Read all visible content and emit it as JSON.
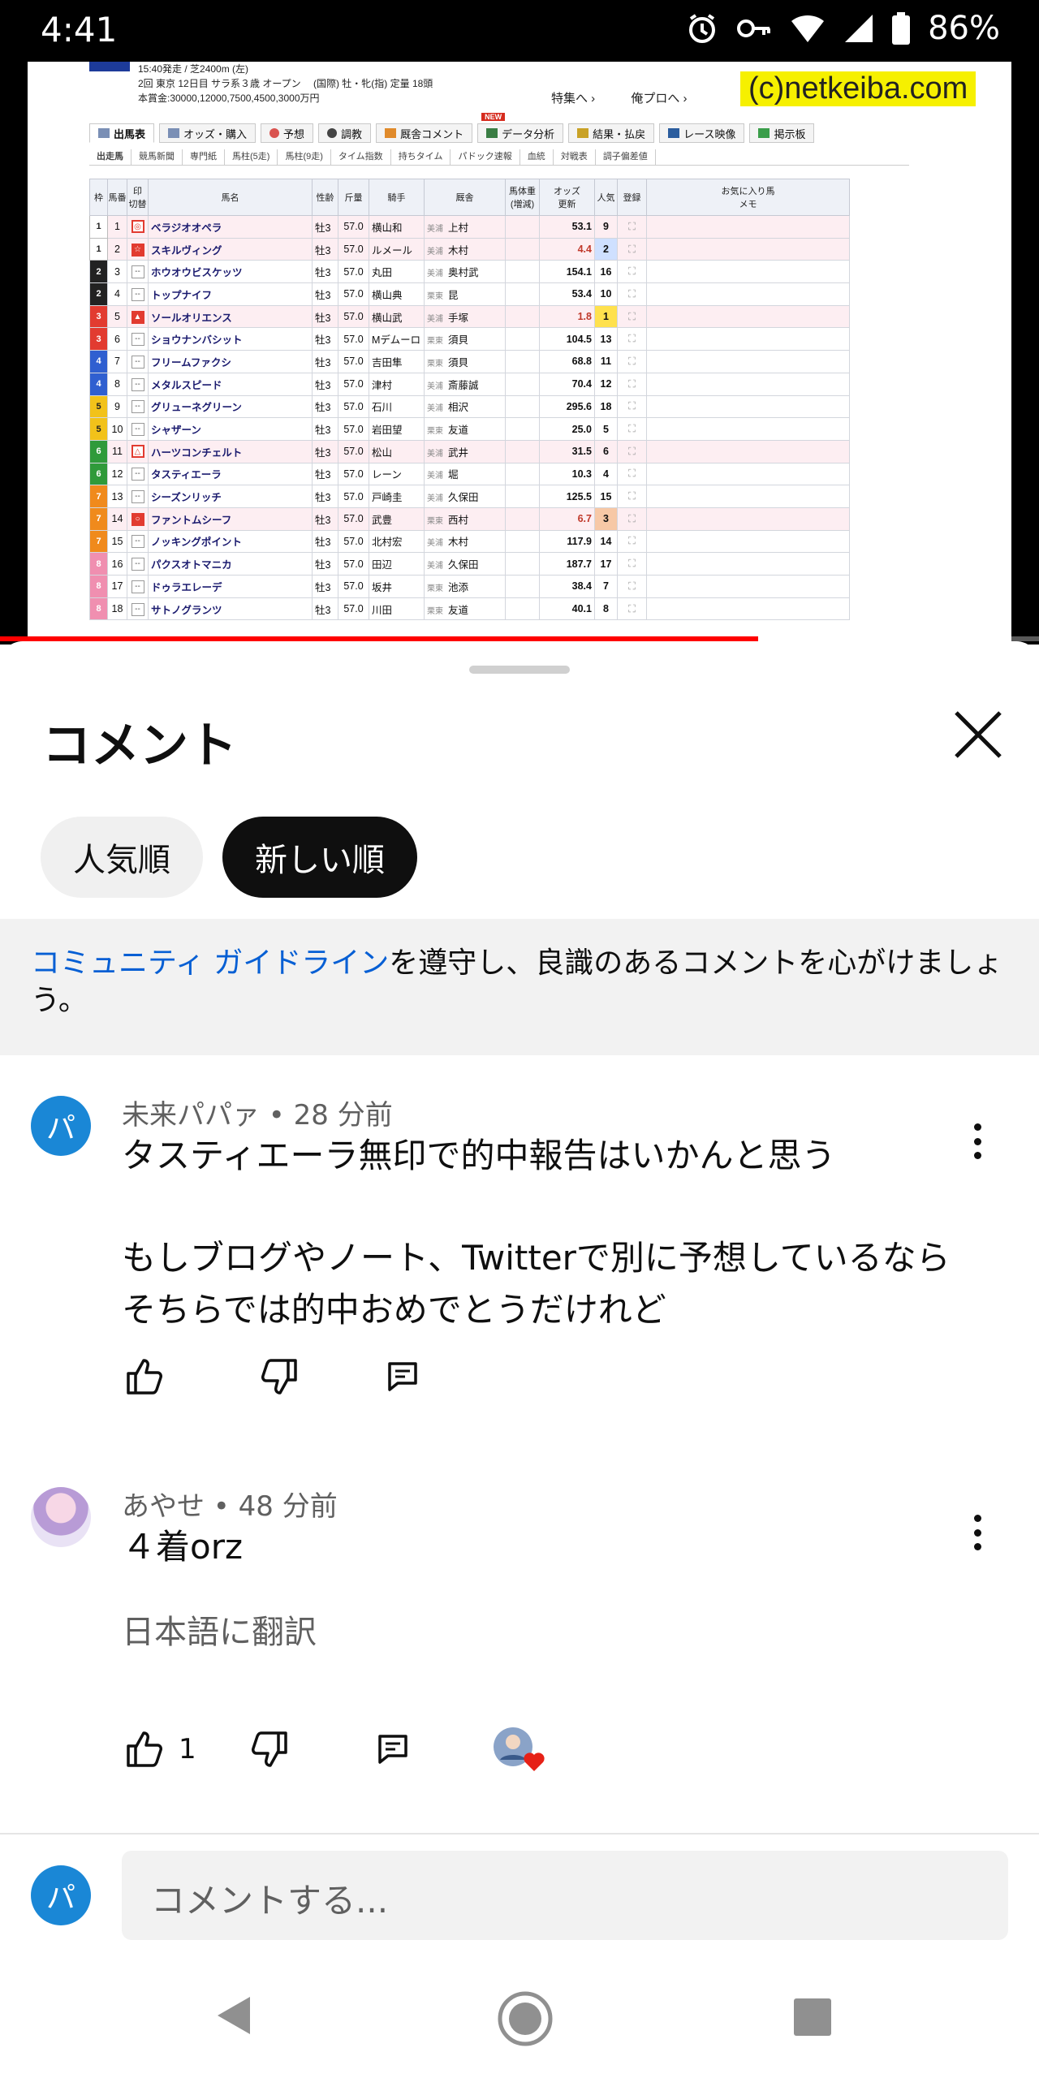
{
  "status_bar": {
    "time": "4:41",
    "battery": "86%"
  },
  "video": {
    "header_lines": [
      "15:40発走 / 芝2400m (左)",
      "2回 東京 12日目 サラ系３歳 オープン　 (国際) 牡・牝(指) 定量 18頭",
      "本賞金:30000,12000,7500,4500,3000万円"
    ],
    "links": [
      "特集へ ›",
      "俺プロへ ›"
    ],
    "watermark": "(c)netkeiba.com",
    "nav_tabs": [
      "出馬表",
      "オッズ・購入",
      "予想",
      "調教",
      "厩舎コメント",
      "データ分析",
      "結果・払戻",
      "レース映像",
      "掲示板"
    ],
    "new_badge": "NEW",
    "sub_tabs": [
      "出走馬",
      "競馬新聞",
      "専門紙",
      "馬柱(5走)",
      "馬柱(9走)",
      "タイム指数",
      "持ちタイム",
      "パドック速報",
      "血統",
      "対戦表",
      "調子偏差値"
    ],
    "table_headers": {
      "waku": "枠",
      "num": "馬番",
      "mark": "印",
      "mark_sub": "切替",
      "name": "馬名",
      "sex": "性齢",
      "wt": "斤量",
      "jockey": "騎手",
      "trainer": "厩舎",
      "bw": "馬体重",
      "bw_sub": "(増減)",
      "odds": "オッズ",
      "odds_sub": "更新",
      "pop": "人気",
      "fav": "お気に入り馬",
      "reg": "登録",
      "memo": "メモ"
    },
    "rows": [
      {
        "waku": "1",
        "num": "1",
        "mark": "◎",
        "name": "ベラジオオペラ",
        "sex": "牡3",
        "wt": "57.0",
        "jockey": "横山和",
        "loc": "美浦",
        "trainer": "上村",
        "odds": "53.1",
        "pop": "9"
      },
      {
        "waku": "1",
        "num": "2",
        "mark": "☆",
        "name": "スキルヴィング",
        "sex": "牡3",
        "wt": "57.0",
        "jockey": "ルメール",
        "loc": "美浦",
        "trainer": "木村",
        "odds": "4.4",
        "pop": "2"
      },
      {
        "waku": "2",
        "num": "3",
        "mark": "--",
        "name": "ホウオウビスケッツ",
        "sex": "牡3",
        "wt": "57.0",
        "jockey": "丸田",
        "loc": "美浦",
        "trainer": "奥村武",
        "odds": "154.1",
        "pop": "16"
      },
      {
        "waku": "2",
        "num": "4",
        "mark": "--",
        "name": "トップナイフ",
        "sex": "牡3",
        "wt": "57.0",
        "jockey": "横山典",
        "loc": "栗東",
        "trainer": "昆",
        "odds": "53.4",
        "pop": "10"
      },
      {
        "waku": "3",
        "num": "5",
        "mark": "▲",
        "name": "ソールオリエンス",
        "sex": "牡3",
        "wt": "57.0",
        "jockey": "横山武",
        "loc": "美浦",
        "trainer": "手塚",
        "odds": "1.8",
        "pop": "1"
      },
      {
        "waku": "3",
        "num": "6",
        "mark": "--",
        "name": "ショウナンバシット",
        "sex": "牡3",
        "wt": "57.0",
        "jockey": "Mデムーロ",
        "loc": "栗東",
        "trainer": "須貝",
        "odds": "104.5",
        "pop": "13"
      },
      {
        "waku": "4",
        "num": "7",
        "mark": "--",
        "name": "フリームファクシ",
        "sex": "牡3",
        "wt": "57.0",
        "jockey": "吉田隼",
        "loc": "栗東",
        "trainer": "須貝",
        "odds": "68.8",
        "pop": "11"
      },
      {
        "waku": "4",
        "num": "8",
        "mark": "--",
        "name": "メタルスピード",
        "sex": "牡3",
        "wt": "57.0",
        "jockey": "津村",
        "loc": "美浦",
        "trainer": "斎藤誠",
        "odds": "70.4",
        "pop": "12"
      },
      {
        "waku": "5",
        "num": "9",
        "mark": "--",
        "name": "グリューネグリーン",
        "sex": "牡3",
        "wt": "57.0",
        "jockey": "石川",
        "loc": "美浦",
        "trainer": "相沢",
        "odds": "295.6",
        "pop": "18"
      },
      {
        "waku": "5",
        "num": "10",
        "mark": "--",
        "name": "シャザーン",
        "sex": "牡3",
        "wt": "57.0",
        "jockey": "岩田望",
        "loc": "栗東",
        "trainer": "友道",
        "odds": "25.0",
        "pop": "5"
      },
      {
        "waku": "6",
        "num": "11",
        "mark": "△",
        "name": "ハーツコンチェルト",
        "sex": "牡3",
        "wt": "57.0",
        "jockey": "松山",
        "loc": "美浦",
        "trainer": "武井",
        "odds": "31.5",
        "pop": "6"
      },
      {
        "waku": "6",
        "num": "12",
        "mark": "--",
        "name": "タスティエーラ",
        "sex": "牡3",
        "wt": "57.0",
        "jockey": "レーン",
        "loc": "美浦",
        "trainer": "堀",
        "odds": "10.3",
        "pop": "4"
      },
      {
        "waku": "7",
        "num": "13",
        "mark": "--",
        "name": "シーズンリッチ",
        "sex": "牡3",
        "wt": "57.0",
        "jockey": "戸崎圭",
        "loc": "美浦",
        "trainer": "久保田",
        "odds": "125.5",
        "pop": "15"
      },
      {
        "waku": "7",
        "num": "14",
        "mark": "○",
        "name": "ファントムシーフ",
        "sex": "牡3",
        "wt": "57.0",
        "jockey": "武豊",
        "loc": "栗東",
        "trainer": "西村",
        "odds": "6.7",
        "pop": "3"
      },
      {
        "waku": "7",
        "num": "15",
        "mark": "--",
        "name": "ノッキングポイント",
        "sex": "牡3",
        "wt": "57.0",
        "jockey": "北村宏",
        "loc": "美浦",
        "trainer": "木村",
        "odds": "117.9",
        "pop": "14"
      },
      {
        "waku": "8",
        "num": "16",
        "mark": "--",
        "name": "パクスオトマニカ",
        "sex": "牡3",
        "wt": "57.0",
        "jockey": "田辺",
        "loc": "美浦",
        "trainer": "久保田",
        "odds": "187.7",
        "pop": "17"
      },
      {
        "waku": "8",
        "num": "17",
        "mark": "--",
        "name": "ドゥラエレーデ",
        "sex": "牡3",
        "wt": "57.0",
        "jockey": "坂井",
        "loc": "栗東",
        "trainer": "池添",
        "odds": "38.4",
        "pop": "7"
      },
      {
        "waku": "8",
        "num": "18",
        "mark": "--",
        "name": "サトノグランツ",
        "sex": "牡3",
        "wt": "57.0",
        "jockey": "川田",
        "loc": "栗東",
        "trainer": "友道",
        "odds": "40.1",
        "pop": "8"
      }
    ],
    "progress": 0.73
  },
  "comments_sheet": {
    "title": "コメント",
    "sort_chips": [
      "人気順",
      "新しい順"
    ],
    "guideline_link": "コミュニティ ガイドライン",
    "guideline_rest": "を遵守し、良識のあるコメントを心がけましょう。",
    "comments": [
      {
        "avatar_letter": "パ",
        "meta": "未来パパァ • 28 分前",
        "text_1": "タスティエーラ無印で的中報告はいかんと思う",
        "text_2": "もしブログやノート、Twitterで別に予想しているならそちらでは的中おめでとうだけれど",
        "likes": ""
      },
      {
        "meta": "あやせ • 48 分前",
        "text_1": "４着orz",
        "translate": "日本語に翻訳",
        "likes": "1"
      }
    ],
    "input_avatar_letter": "パ",
    "input_placeholder": "コメントする..."
  },
  "colors": {
    "accent_red": "#ff0000",
    "link_blue": "#065fd4",
    "avatar_blue": "#1a87d6"
  },
  "icons": [
    "alarm-icon",
    "key-icon",
    "wifi-icon",
    "signal-icon",
    "battery-icon",
    "close-icon",
    "more-vert-icon",
    "like-icon",
    "dislike-icon",
    "reply-icon",
    "creator-heart-icon",
    "back-icon",
    "home-icon",
    "recents-icon"
  ]
}
